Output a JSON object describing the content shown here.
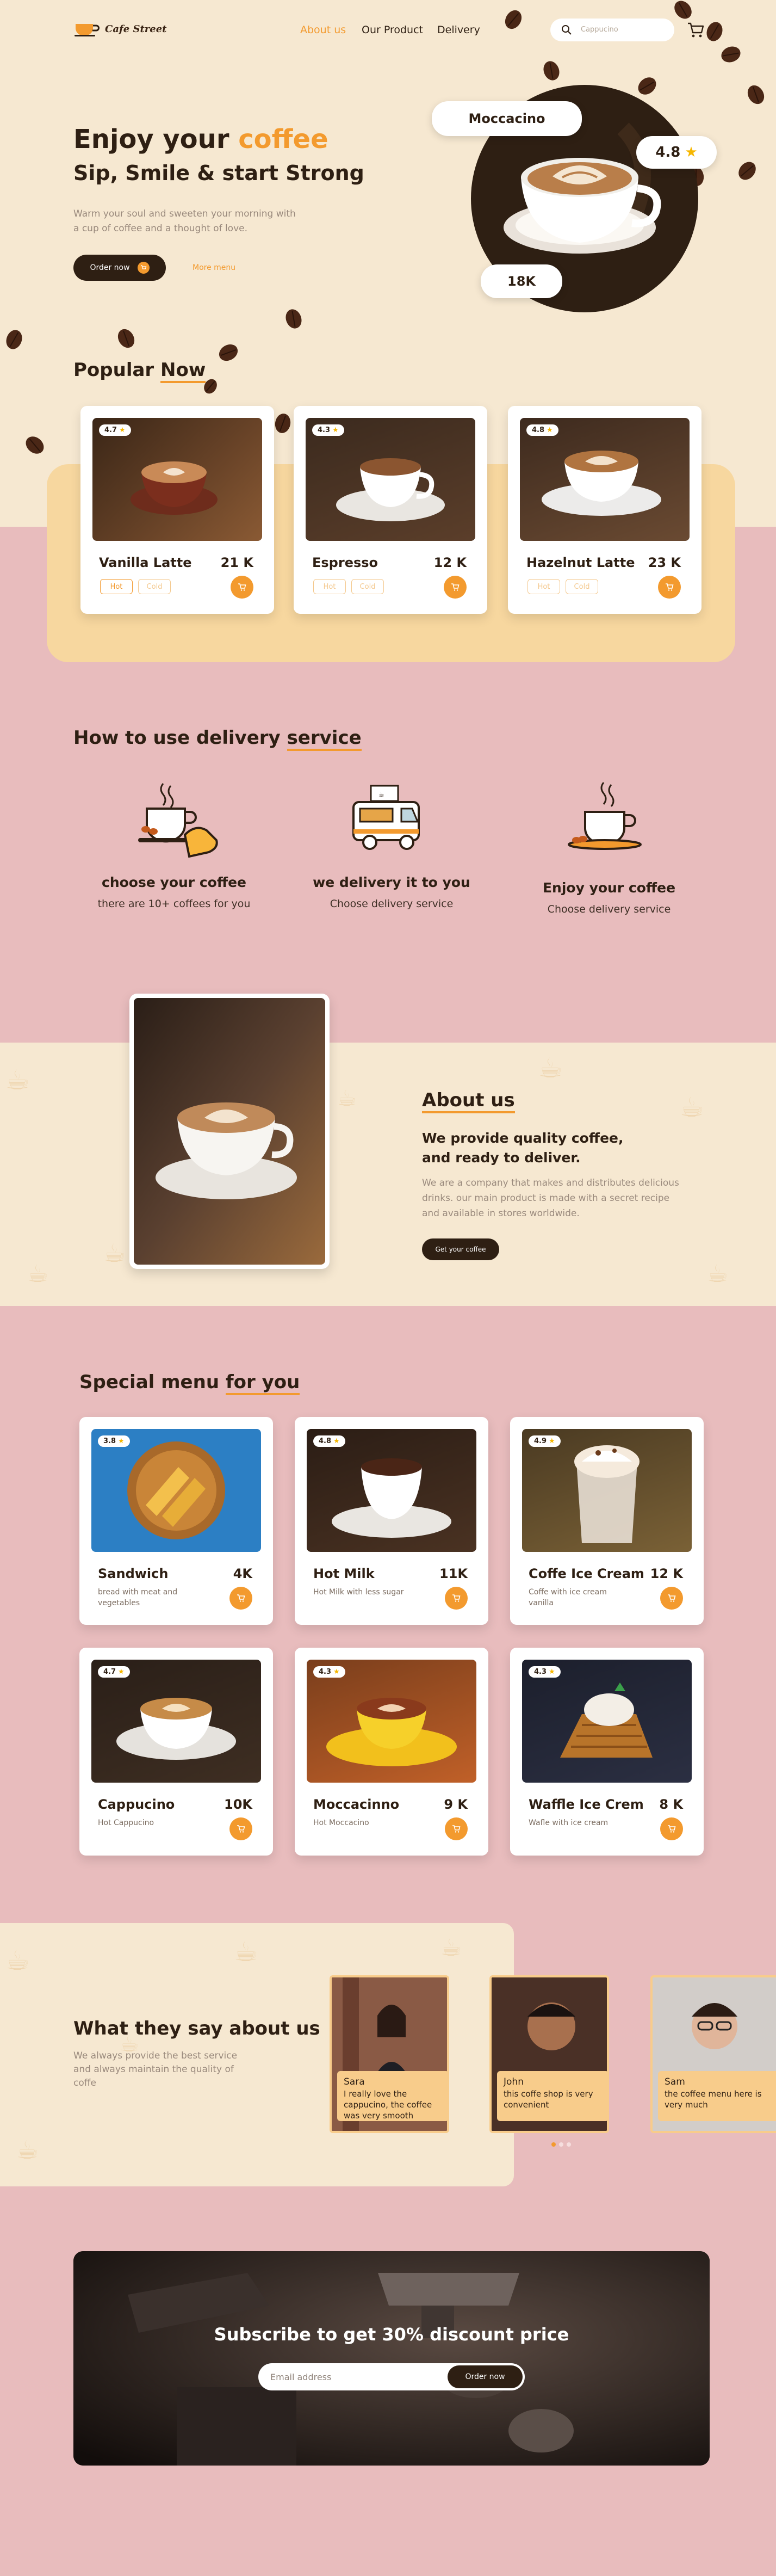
{
  "brand": {
    "name": "Cafe Street"
  },
  "nav": {
    "links": [
      "About us",
      "Our Product",
      "Delivery"
    ],
    "search_placeholder": "Cappucino"
  },
  "hero": {
    "title_a": "Enjoy your",
    "title_b": "coffee",
    "subtitle": "Sip, Smile & start Strong",
    "description": "Warm your soul and sweeten your morning with a cup of coffee and a thought of love.",
    "order_btn": "Order now",
    "more_link": "More menu",
    "product_name": "Moccacino",
    "rating": "4.8",
    "count": "18K"
  },
  "popular": {
    "title_a": "Popular",
    "title_b": "Now",
    "items": [
      {
        "rating": "4.7",
        "name": "Vanilla Latte",
        "price": "21 K",
        "hot": "Hot",
        "cold": "Cold"
      },
      {
        "rating": "4.3",
        "name": "Espresso",
        "price": "12 K",
        "hot": "Hot",
        "cold": "Cold"
      },
      {
        "rating": "4.8",
        "name": "Hazelnut Latte",
        "price": "23 K",
        "hot": "Hot",
        "cold": "Cold"
      }
    ]
  },
  "how": {
    "title_a": "How to use delivery",
    "title_b": "service",
    "steps": [
      {
        "title": "choose your coffee",
        "sub": "there are 10+ coffees for you"
      },
      {
        "title": "we delivery it to you",
        "sub": "Choose delivery service"
      },
      {
        "title": "Enjoy your coffee",
        "sub": "Choose delivery service"
      }
    ]
  },
  "about": {
    "title": "About us",
    "headline": "We provide quality coffee, and ready to deliver.",
    "text": "We are a company that makes and distributes delicious drinks. our main product is made with a secret recipe and available in stores worldwide.",
    "btn": "Get your coffee"
  },
  "special": {
    "title_a": "Special menu",
    "title_b": "for you",
    "items": [
      {
        "rating": "3.8",
        "name": "Sandwich",
        "price": "4K",
        "desc": "bread with meat and vegetables"
      },
      {
        "rating": "4.8",
        "name": "Hot Milk",
        "price": "11K",
        "desc": "Hot Milk with less sugar"
      },
      {
        "rating": "4.9",
        "name": "Coffe Ice Cream",
        "price": "12 K",
        "desc": "Coffe with ice cream vanilla"
      },
      {
        "rating": "4.7",
        "name": "Cappucino",
        "price": "10K",
        "desc": "Hot Cappucino"
      },
      {
        "rating": "4.3",
        "name": "Moccacinno",
        "price": "9 K",
        "desc": "Hot Moccacino"
      },
      {
        "rating": "4.3",
        "name": "Waffle Ice Crem",
        "price": "8 K",
        "desc": "Wafle with ice cream"
      }
    ]
  },
  "testimonials": {
    "title": "What they say about us",
    "text": "We always provide the best service and always maintain the quality of coffe",
    "items": [
      {
        "name": "Sara",
        "quote": "I really love the cappucino, the coffee was very smooth"
      },
      {
        "name": "John",
        "quote": "this coffe shop is very convenient"
      },
      {
        "name": "Sam",
        "quote": "the coffee menu here is very much"
      }
    ]
  },
  "subscribe": {
    "title": "Subscribe to get 30% discount price",
    "placeholder": "Email address",
    "btn": "Order now"
  },
  "colors": {
    "accent": "#f39a2e",
    "dark": "#2e1f13",
    "cream": "#f6e8d1",
    "pink": "#e8bcbd"
  }
}
